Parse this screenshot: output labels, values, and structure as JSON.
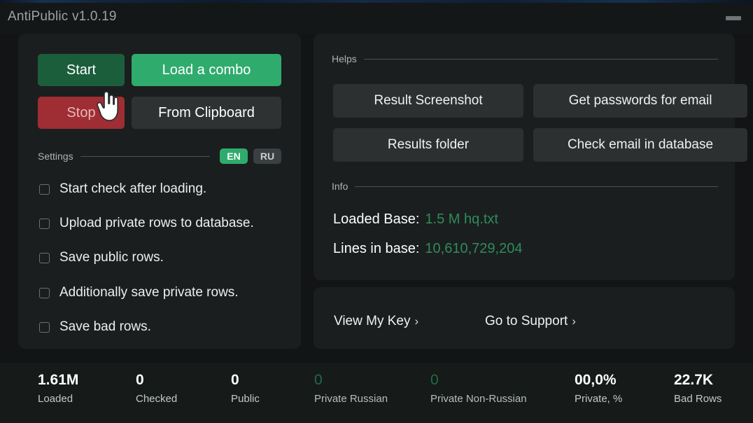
{
  "window": {
    "title": "AntiPublic v1.0.19",
    "minimize_label": "minimize",
    "accent_green": "#2fab6d",
    "accent_dark_green": "#1b5e3c",
    "accent_red": "#9e2d34",
    "panel_bg": "#1b1e1f",
    "app_bg": "#121415"
  },
  "actions": {
    "start": "Start",
    "load_combo": "Load a combo",
    "stop": "Stop",
    "from_clipboard": "From Clipboard"
  },
  "settings": {
    "section_label": "Settings",
    "languages": [
      {
        "code": "EN",
        "active": true
      },
      {
        "code": "RU",
        "active": false
      }
    ],
    "options": [
      {
        "label": "Start check after loading.",
        "checked": false
      },
      {
        "label": "Upload private rows to database.",
        "checked": false
      },
      {
        "label": "Save public rows.",
        "checked": false
      },
      {
        "label": "Additionally save private rows.",
        "checked": false
      },
      {
        "label": "Save bad rows.",
        "checked": false
      }
    ]
  },
  "helps": {
    "section_label": "Helps",
    "buttons": [
      "Result Screenshot",
      "Get passwords for email",
      "Results folder",
      "Check email in database"
    ]
  },
  "info": {
    "section_label": "Info",
    "rows": [
      {
        "key": "Loaded Base:",
        "value": "1.5 M hq.txt"
      },
      {
        "key": "Lines in base:",
        "value": "10,610,729,204"
      }
    ]
  },
  "links": {
    "view_key": "View My Key",
    "support": "Go to Support",
    "chevron": "›"
  },
  "status": {
    "items": [
      {
        "value": "1.61M",
        "label": "Loaded",
        "green": false
      },
      {
        "value": "0",
        "label": "Checked",
        "green": false
      },
      {
        "value": "0",
        "label": "Public",
        "green": false
      },
      {
        "value": "0",
        "label": "Private Russian",
        "green": true
      },
      {
        "value": "0",
        "label": "Private Non-Russian",
        "green": true
      },
      {
        "value": "00,0%",
        "label": "Private, %",
        "green": false
      },
      {
        "value": "22.7K",
        "label": "Bad Rows",
        "green": false
      }
    ]
  }
}
